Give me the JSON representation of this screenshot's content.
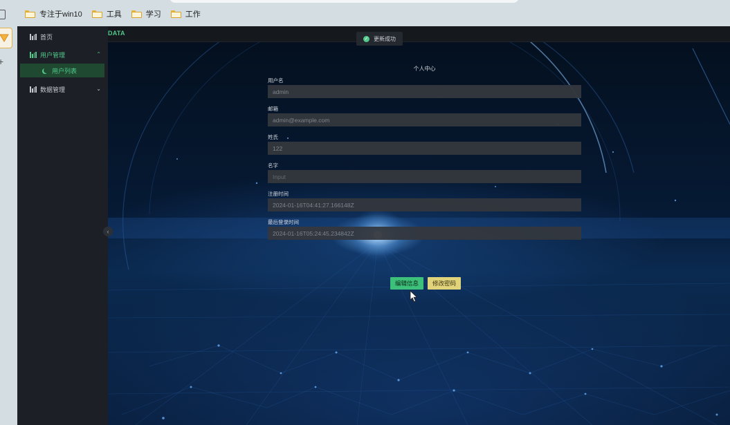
{
  "browser": {
    "bookmarks": [
      {
        "label": "专注于win10"
      },
      {
        "label": "工具"
      },
      {
        "label": "学习"
      },
      {
        "label": "工作"
      }
    ]
  },
  "app": {
    "brand": "DATA",
    "sidebar": {
      "items": [
        {
          "label": "首页",
          "icon": "bar-chart-icon"
        },
        {
          "label": "用户管理",
          "icon": "bar-chart-icon",
          "expanded": true,
          "children": [
            {
              "label": "用户列表"
            }
          ]
        },
        {
          "label": "数据管理",
          "icon": "bar-chart-icon",
          "expanded": false
        }
      ]
    },
    "toast": {
      "message": "更新成功"
    },
    "profile": {
      "title": "个人中心",
      "fields": [
        {
          "label": "用户名",
          "value": "admin",
          "placeholder": ""
        },
        {
          "label": "邮箱",
          "value": "admin@example.com",
          "placeholder": ""
        },
        {
          "label": "姓氏",
          "value": "122",
          "placeholder": ""
        },
        {
          "label": "名字",
          "value": "",
          "placeholder": "Input"
        },
        {
          "label": "注册时间",
          "value": "2024-01-16T04:41:27.166148Z",
          "placeholder": ""
        },
        {
          "label": "最后登录时间",
          "value": "2024-01-16T05:24:45.234842Z",
          "placeholder": ""
        }
      ],
      "buttons": {
        "edit": "编辑信息",
        "change_password": "修改密码"
      }
    }
  },
  "colors": {
    "accent": "#52c98a",
    "edit_button": "#3cc07a",
    "password_button": "#e0d37a",
    "sidebar_bg": "#1c1f25"
  }
}
